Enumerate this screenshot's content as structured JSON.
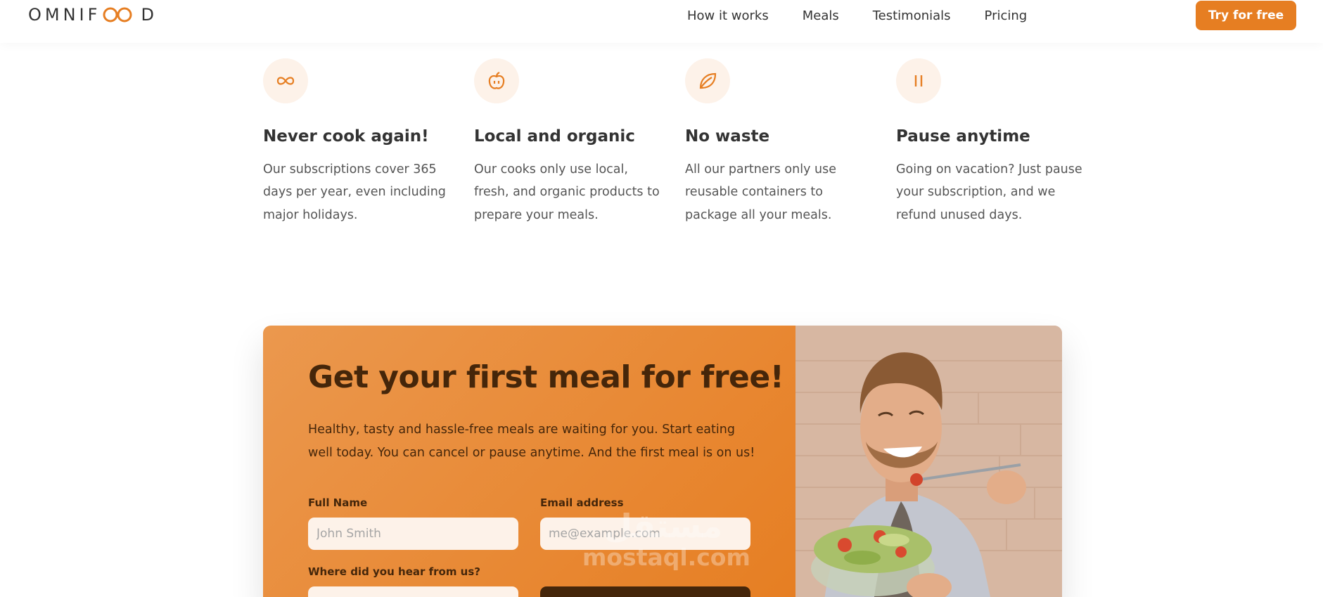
{
  "header": {
    "logo_text_left": "OMNIF",
    "logo_text_right": "D",
    "nav": [
      "How it works",
      "Meals",
      "Testimonials",
      "Pricing"
    ],
    "cta_label": "Try for free"
  },
  "features": [
    {
      "icon": "infinity-icon",
      "title": "Never cook again!",
      "text": "Our subscriptions cover 365 days per year, even including major holidays."
    },
    {
      "icon": "apple-icon",
      "title": "Local and organic",
      "text": "Our cooks only use local, fresh, and organic products to prepare your meals."
    },
    {
      "icon": "leaf-icon",
      "title": "No waste",
      "text": "All our partners only use reusable containers to package all your meals."
    },
    {
      "icon": "pause-icon",
      "title": "Pause anytime",
      "text": "Going on vacation? Just pause your subscription, and we refund unused days."
    }
  ],
  "cta": {
    "heading": "Get your first meal for free!",
    "description": "Healthy, tasty and hassle-free meals are waiting for you. Start eating well today. You can cancel or pause anytime. And the first meal is on us!",
    "full_name_label": "Full Name",
    "full_name_placeholder": "John Smith",
    "email_label": "Email address",
    "email_placeholder": "me@example.com",
    "source_label": "Where did you hear from us?"
  },
  "watermark": {
    "arabic": "مستقل",
    "latin": "mostaql.com"
  },
  "colors": {
    "accent": "#e67e22",
    "accent_light": "#fdf2e9",
    "dark_brown": "#45260a"
  }
}
